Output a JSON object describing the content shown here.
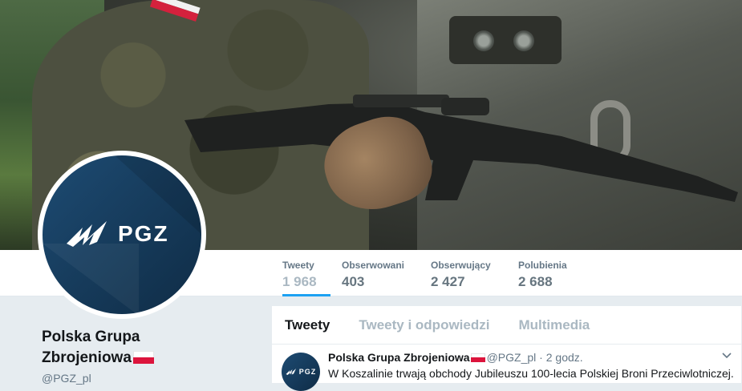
{
  "stats": [
    {
      "label": "Tweety",
      "value": "1 968"
    },
    {
      "label": "Obserwowani",
      "value": "403"
    },
    {
      "label": "Obserwujący",
      "value": "2 427"
    },
    {
      "label": "Polubienia",
      "value": "2 688"
    }
  ],
  "avatar": {
    "logo_text": "PGZ",
    "mini_text": "PGZ"
  },
  "profile": {
    "name_line1": "Polska Grupa",
    "name_line2": "Zbrojeniowa",
    "handle": "@PGZ_pl"
  },
  "tabs": [
    "Tweety",
    "Tweety i odpowiedzi",
    "Multimedia"
  ],
  "tweet": {
    "author": "Polska Grupa Zbrojeniowa",
    "handle": "@PGZ_pl",
    "separator": "·",
    "time": "2 godz.",
    "text": "W Koszalinie trwają obchody Jubileuszu 100-lecia Polskiej Broni Przeciwlotniczej."
  },
  "icons": {
    "caret": "chevron-down-icon",
    "flag": "poland-flag-icon"
  },
  "colors": {
    "accent": "#1da1f2",
    "brand_navy": "#173d5e",
    "flag_red": "#dc143c"
  }
}
